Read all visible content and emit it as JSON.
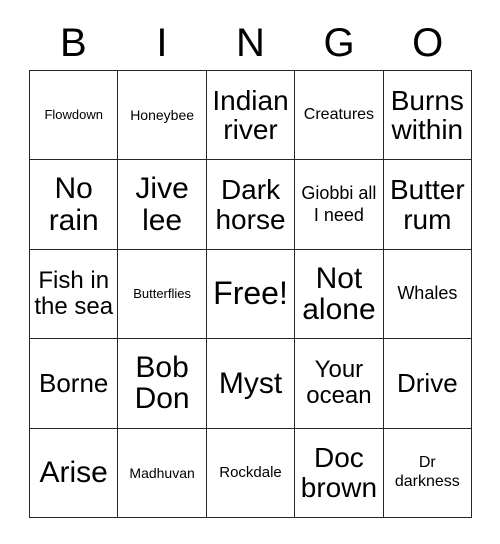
{
  "card": {
    "title": "Bingo Card",
    "background_color": "#ffffff",
    "border_color": "#262626",
    "text_color": "#000000"
  },
  "header": {
    "letters": [
      {
        "label": "B"
      },
      {
        "label": "I"
      },
      {
        "label": "N"
      },
      {
        "label": "G"
      },
      {
        "label": "O"
      }
    ]
  },
  "grid": {
    "columns": 5,
    "rows": 5,
    "free_space": {
      "row": 3,
      "column": 3,
      "label": "Free!"
    },
    "cells": [
      [
        {
          "label": "Flowdown",
          "size": "fs-xs"
        },
        {
          "label": "Honeybee",
          "size": "fs-sm"
        },
        {
          "label": "Indian river",
          "size": "fs-3xl"
        },
        {
          "label": "Creatures",
          "size": "fs-md"
        },
        {
          "label": "Burns within",
          "size": "fs-3xl"
        }
      ],
      [
        {
          "label": "No rain",
          "size": "fs-4xl"
        },
        {
          "label": "Jive lee",
          "size": "fs-4xl"
        },
        {
          "label": "Dark horse",
          "size": "fs-3xl"
        },
        {
          "label": "Giobbi all I need",
          "size": "fs-mdp"
        },
        {
          "label": "Butter rum",
          "size": "fs-3xl"
        }
      ],
      [
        {
          "label": "Fish in the sea",
          "size": "fs-xl"
        },
        {
          "label": "Butterflies",
          "size": "fs-xs"
        },
        {
          "label": "Free!",
          "size": "fs-5xl"
        },
        {
          "label": "Not alone",
          "size": "fs-4xl"
        },
        {
          "label": "Whales",
          "size": "fs-mdp"
        }
      ],
      [
        {
          "label": "Borne",
          "size": "fs-2xl"
        },
        {
          "label": "Bob Don",
          "size": "fs-4xl"
        },
        {
          "label": "Myst",
          "size": "fs-4xl"
        },
        {
          "label": "Your ocean",
          "size": "fs-xl"
        },
        {
          "label": "Drive",
          "size": "fs-2xl"
        }
      ],
      [
        {
          "label": "Arise",
          "size": "fs-4xl"
        },
        {
          "label": "Madhuvan",
          "size": "fs-sm"
        },
        {
          "label": "Rockdale",
          "size": "fs-smp"
        },
        {
          "label": "Doc brown",
          "size": "fs-3xl"
        },
        {
          "label": "Dr darkness",
          "size": "fs-md"
        }
      ]
    ]
  }
}
